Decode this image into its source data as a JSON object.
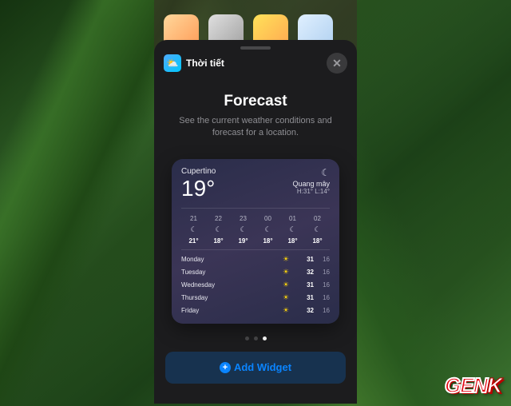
{
  "header": {
    "app_name": "Thời tiết",
    "close_label": "✕"
  },
  "title_block": {
    "title": "Forecast",
    "subtitle": "See the current weather conditions and forecast for a location."
  },
  "widget": {
    "location": "Cupertino",
    "temperature": "19°",
    "condition_icon": "☾",
    "condition_text": "Quang mây",
    "hilo": "H:31° L:14°",
    "hourly": [
      {
        "hour": "21",
        "icon": "☾",
        "temp": "21°"
      },
      {
        "hour": "22",
        "icon": "☾",
        "temp": "18°"
      },
      {
        "hour": "23",
        "icon": "☾",
        "temp": "19°"
      },
      {
        "hour": "00",
        "icon": "☾",
        "temp": "18°"
      },
      {
        "hour": "01",
        "icon": "☾",
        "temp": "18°"
      },
      {
        "hour": "02",
        "icon": "☾",
        "temp": "18°"
      }
    ],
    "daily": [
      {
        "day": "Monday",
        "icon": "☀",
        "hi": "31",
        "lo": "16"
      },
      {
        "day": "Tuesday",
        "icon": "☀",
        "hi": "32",
        "lo": "16"
      },
      {
        "day": "Wednesday",
        "icon": "☀",
        "hi": "31",
        "lo": "16"
      },
      {
        "day": "Thursday",
        "icon": "☀",
        "hi": "31",
        "lo": "16"
      },
      {
        "day": "Friday",
        "icon": "☀",
        "hi": "32",
        "lo": "16"
      }
    ]
  },
  "pagination": {
    "count": 3,
    "active": 2
  },
  "add_button": {
    "label": "Add Widget"
  },
  "watermark": {
    "text_main": "GEN",
    "text_k": "K"
  }
}
